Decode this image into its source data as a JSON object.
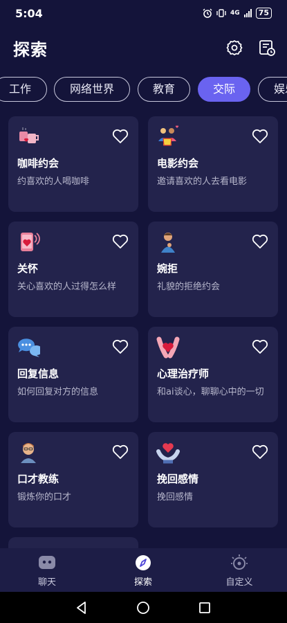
{
  "status": {
    "time": "5:04",
    "signal_tag": "4G",
    "battery": "75"
  },
  "header": {
    "title": "探索"
  },
  "tabs": [
    {
      "label": "工作"
    },
    {
      "label": "网络世界"
    },
    {
      "label": "教育"
    },
    {
      "label": "交际"
    },
    {
      "label": "娱乐"
    }
  ],
  "cards": [
    {
      "title": "咖啡约会",
      "desc": "约喜欢的人喝咖啡",
      "icon": "coffee-cups-icon"
    },
    {
      "title": "电影约会",
      "desc": "邀请喜欢的人去看电影",
      "icon": "movie-date-icon"
    },
    {
      "title": "关怀",
      "desc": "关心喜欢的人过得怎么样",
      "icon": "phone-heart-icon"
    },
    {
      "title": "婉拒",
      "desc": "礼貌的拒绝约会",
      "icon": "thinking-person-icon"
    },
    {
      "title": "回复信息",
      "desc": "如何回复对方的信息",
      "icon": "chat-bubbles-icon"
    },
    {
      "title": "心理治疗师",
      "desc": "和ai谈心，聊聊心中的一切",
      "icon": "hug-heart-icon"
    },
    {
      "title": "口才教练",
      "desc": "锻炼你的口才",
      "icon": "coach-avatar-icon"
    },
    {
      "title": "挽回感情",
      "desc": "挽回感情",
      "icon": "hands-heart-icon"
    }
  ],
  "bottom_nav": [
    {
      "label": "聊天"
    },
    {
      "label": "探索"
    },
    {
      "label": "自定义"
    }
  ],
  "colors": {
    "accent": "#6a63f0",
    "background": "#14143a",
    "card": "#23234c"
  }
}
